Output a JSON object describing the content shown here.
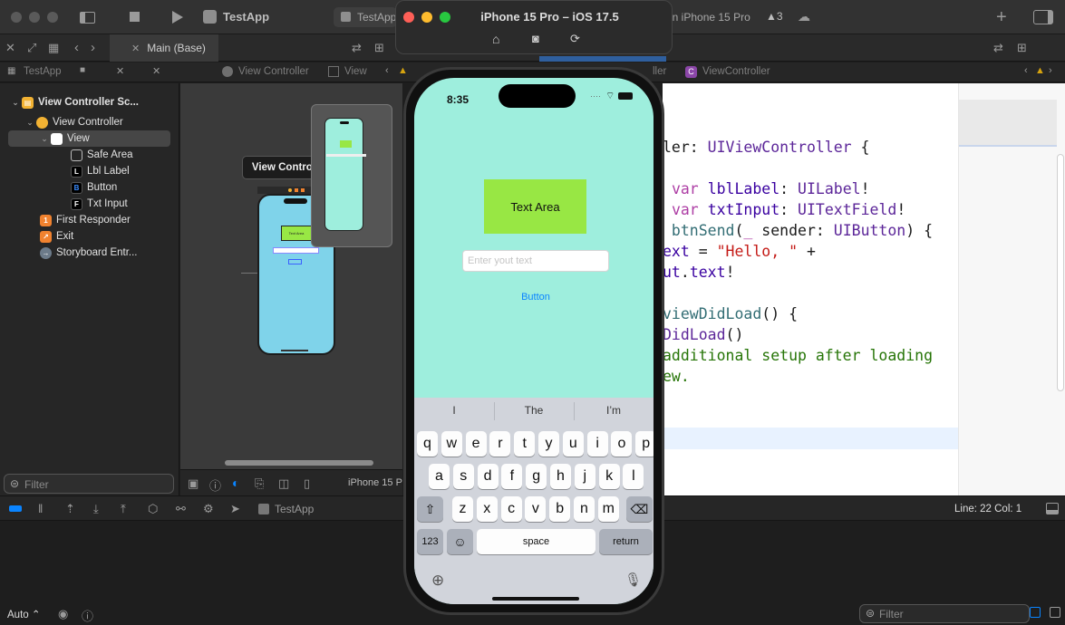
{
  "xcode": {
    "scheme": "TestApp",
    "tab_left": "TestApp",
    "tab_right": "on iPhone 15 Pro",
    "warnings": "3",
    "editor_tab": "Main (Base)",
    "jump_left": [
      "TestApp",
      "View Controller",
      "View"
    ],
    "jump_right": [
      "ller",
      "ViewController"
    ],
    "device_label": "iPhone 15 P",
    "filter_placeholder": "Filter",
    "status": "Line: 22  Col: 1",
    "debug_target": "TestApp",
    "auto_label": "Auto"
  },
  "navigator": {
    "items": [
      {
        "label": "View Controller Sc...",
        "icon": "scene-icon"
      },
      {
        "label": "View Controller",
        "icon": "viewcontroller-icon"
      },
      {
        "label": "View",
        "icon": "view-icon"
      },
      {
        "label": "Safe Area",
        "icon": "safearea-icon"
      },
      {
        "label": "Lbl Label",
        "icon": "label-icon",
        "glyph": "L"
      },
      {
        "label": "Button",
        "icon": "button-icon",
        "glyph": "B"
      },
      {
        "label": "Txt Input",
        "icon": "textfield-icon",
        "glyph": "F"
      },
      {
        "label": "First Responder",
        "icon": "first-responder-icon",
        "glyph": "1"
      },
      {
        "label": "Exit",
        "icon": "exit-icon",
        "glyph": "↗"
      },
      {
        "label": "Storyboard Entr...",
        "icon": "entry-icon",
        "glyph": "→"
      }
    ]
  },
  "canvas": {
    "tooltip": "View Controller",
    "mini_text_area": "Text Area"
  },
  "code": {
    "lines": [
      [
        {
          "t": "ler: ",
          "c": ""
        },
        {
          "t": "UIViewController",
          "c": "ty"
        },
        {
          "t": " {",
          "c": ""
        }
      ],
      [],
      [
        {
          "t": " ",
          "c": ""
        },
        {
          "t": "var",
          "c": "kw"
        },
        {
          "t": " ",
          "c": ""
        },
        {
          "t": "lblLabel",
          "c": "id"
        },
        {
          "t": ": ",
          "c": ""
        },
        {
          "t": "UILabel",
          "c": "ty"
        },
        {
          "t": "!",
          "c": ""
        }
      ],
      [
        {
          "t": " ",
          "c": ""
        },
        {
          "t": "var",
          "c": "kw"
        },
        {
          "t": " ",
          "c": ""
        },
        {
          "t": "txtInput",
          "c": "id"
        },
        {
          "t": ": ",
          "c": ""
        },
        {
          "t": "UITextField",
          "c": "ty"
        },
        {
          "t": "!",
          "c": ""
        }
      ],
      [
        {
          "t": " btnSend",
          "c": "fn"
        },
        {
          "t": "(",
          "c": ""
        },
        {
          "t": "_",
          "c": "kw"
        },
        {
          "t": " sender: ",
          "c": ""
        },
        {
          "t": "UIButton",
          "c": "ty"
        },
        {
          "t": ") {",
          "c": ""
        }
      ],
      [
        {
          "t": "ext",
          "c": "id"
        },
        {
          "t": " = ",
          "c": ""
        },
        {
          "t": "\"Hello, \"",
          "c": "st"
        },
        {
          "t": " +",
          "c": ""
        }
      ],
      [
        {
          "t": "ut",
          "c": "id"
        },
        {
          "t": ".",
          "c": ""
        },
        {
          "t": "text",
          "c": "id"
        },
        {
          "t": "!",
          "c": ""
        }
      ],
      [],
      [
        {
          "t": "viewDidLoad",
          "c": "fn"
        },
        {
          "t": "() {",
          "c": ""
        }
      ],
      [
        {
          "t": "DidLoad",
          "c": "ty"
        },
        {
          "t": "()",
          "c": ""
        }
      ],
      [
        {
          "t": "additional setup after loading",
          "c": "cm"
        }
      ],
      [
        {
          "t": "ew.",
          "c": "cm"
        }
      ]
    ]
  },
  "simulator": {
    "title": "iPhone 15 Pro – iOS 17.5",
    "time": "8:35",
    "label_text": "Text Area",
    "input_placeholder": "Enter yout text",
    "button_label": "Button",
    "suggestions": [
      "I",
      "The",
      "I’m"
    ],
    "keys_row1": [
      "q",
      "w",
      "e",
      "r",
      "t",
      "y",
      "u",
      "i",
      "o",
      "p"
    ],
    "keys_row2": [
      "a",
      "s",
      "d",
      "f",
      "g",
      "h",
      "j",
      "k",
      "l"
    ],
    "keys_row3": [
      "z",
      "x",
      "c",
      "v",
      "b",
      "n",
      "m"
    ],
    "key_numbers": "123",
    "key_space": "space",
    "key_return": "return",
    "colors": {
      "screen_bg": "#9eeedd",
      "label_bg": "#98e744",
      "accent": "#0a84ff"
    }
  }
}
